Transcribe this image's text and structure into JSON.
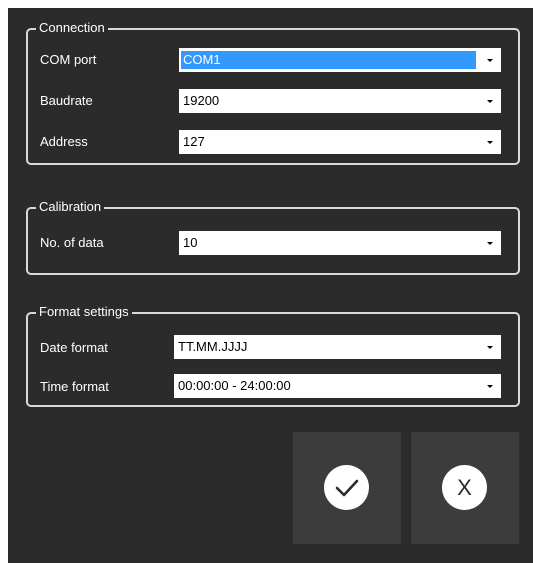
{
  "connection": {
    "title": "Connection",
    "com_port": {
      "label": "COM port",
      "value": "COM1"
    },
    "baudrate": {
      "label": "Baudrate",
      "value": "19200"
    },
    "address": {
      "label": "Address",
      "value": "127"
    }
  },
  "calibration": {
    "title": "Calibration",
    "num_data": {
      "label": "No. of data",
      "value": "10"
    }
  },
  "format": {
    "title": "Format settings",
    "date_format": {
      "label": "Date format",
      "value": "TT.MM.JJJJ"
    },
    "time_format": {
      "label": "Time format",
      "value": "00:00:00 - 24:00:00"
    }
  },
  "actions": {
    "confirm_icon": "checkmark-icon",
    "cancel_icon": "x-icon",
    "cancel_glyph": "X"
  },
  "colors": {
    "window_bg": "#2b2b2b",
    "button_bg": "#3c3c3c",
    "selection": "#3399ff"
  }
}
